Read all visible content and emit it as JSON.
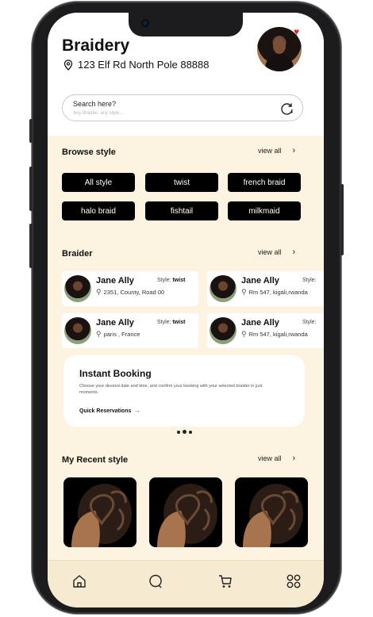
{
  "header": {
    "title": "Braidery",
    "address": "123 Elf Rd North Pole 88888"
  },
  "search": {
    "label": "Search here?",
    "placeholder": "Any Braider, any style..."
  },
  "browse": {
    "title": "Browse style",
    "view_all": "view all",
    "styles": [
      "All style",
      "twist",
      "french braid",
      "halo braid",
      "fishtail",
      "milkmaid"
    ]
  },
  "braiders": {
    "title": "Braider",
    "view_all": "view all",
    "style_label": "Style:",
    "items": [
      {
        "name": "Jane Ally",
        "style": "twist",
        "location": "2351,  County, Road 00"
      },
      {
        "name": "Jane Ally",
        "style": "",
        "location": "Rm 547, kigali,rwanda"
      },
      {
        "name": "Jane Ally",
        "style": "twist",
        "location": "paris , France"
      },
      {
        "name": "Jane Ally",
        "style": "",
        "location": "Rm 547, kigali,rwanda"
      }
    ]
  },
  "booking": {
    "title": "Instant Booking",
    "description": "Choose your desired date and time, and confirm your booking with your selected braider in just moments.",
    "link": "Quick Reservations",
    "arrow": "→"
  },
  "recent": {
    "title": "My Recent style",
    "view_all": "view all"
  },
  "nav": [
    "home-icon",
    "chat-icon",
    "cart-icon",
    "grid-icon"
  ],
  "colors": {
    "background": "#fdf3e1",
    "chip": "#000000",
    "accent_heart": "#e02323"
  }
}
